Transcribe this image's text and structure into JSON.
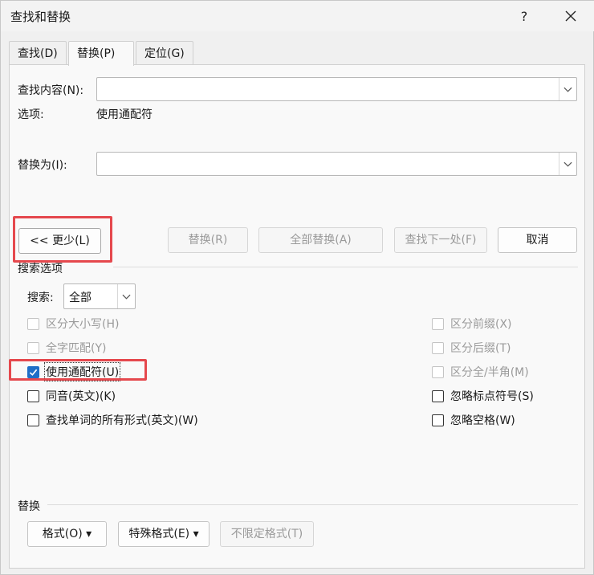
{
  "window": {
    "title": "查找和替换",
    "help_label": "?",
    "close_icon": "close-icon"
  },
  "tabs": [
    {
      "label": "查找(D)",
      "active": false
    },
    {
      "label": "替换(P)",
      "active": true
    },
    {
      "label": "定位(G)",
      "active": false
    }
  ],
  "find": {
    "label": "查找内容(N):",
    "value": "",
    "options_label": "选项:",
    "options_value": "使用通配符"
  },
  "replace": {
    "label": "替换为(I):",
    "value": ""
  },
  "buttons": {
    "less": "<< 更少(L)",
    "replace": "替换(R)",
    "replace_all": "全部替换(A)",
    "find_next": "查找下一处(F)",
    "cancel": "取消"
  },
  "search_options": {
    "section_title": "搜索选项",
    "search_label": "搜索:",
    "search_value": "全部",
    "left_checks": [
      {
        "label": "区分大小写(H)",
        "checked": false,
        "disabled": true
      },
      {
        "label": "全字匹配(Y)",
        "checked": false,
        "disabled": true
      },
      {
        "label": "使用通配符(U)",
        "checked": true,
        "disabled": false
      },
      {
        "label": "同音(英文)(K)",
        "checked": false,
        "disabled": false
      },
      {
        "label": "查找单词的所有形式(英文)(W)",
        "checked": false,
        "disabled": false
      }
    ],
    "right_checks": [
      {
        "label": "区分前缀(X)",
        "checked": false,
        "disabled": true
      },
      {
        "label": "区分后缀(T)",
        "checked": false,
        "disabled": true
      },
      {
        "label": "区分全/半角(M)",
        "checked": false,
        "disabled": true
      },
      {
        "label": "忽略标点符号(S)",
        "checked": false,
        "disabled": false
      },
      {
        "label": "忽略空格(W)",
        "checked": false,
        "disabled": false
      }
    ]
  },
  "replace_section": {
    "title": "替换",
    "format": "格式(O) ▾",
    "special": "特殊格式(E) ▾",
    "no_format": "不限定格式(T)"
  },
  "colors": {
    "highlight": "#e5484d",
    "checkbox_checked": "#1f6ec7"
  }
}
